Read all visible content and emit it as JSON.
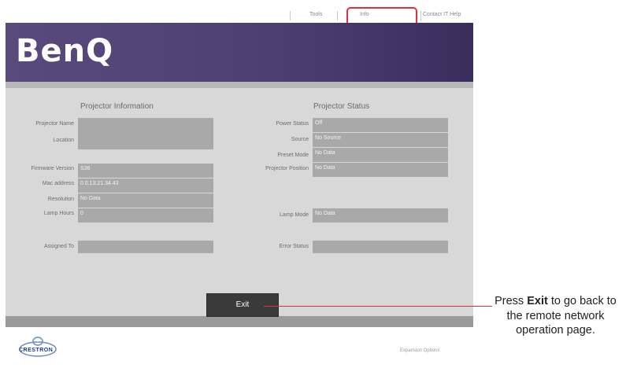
{
  "nav": {
    "tools": "Tools",
    "info": "Info",
    "contact": "Contact IT Help"
  },
  "brand": {
    "logo": "BenQ"
  },
  "projector_information": {
    "title": "Projector Information",
    "projector_name": {
      "label": "Projector Name",
      "value": ""
    },
    "location": {
      "label": "Location",
      "value": ""
    },
    "firmware_version": {
      "label": "Firmware Version",
      "value": "S36"
    },
    "mac_address": {
      "label": "Mac address",
      "value": "0.0.13.21.34.43"
    },
    "resolution": {
      "label": "Resolution",
      "value": "No Data"
    },
    "lamp_hours": {
      "label": "Lamp Hours",
      "value": "0"
    },
    "assigned_to": {
      "label": "Assigned To",
      "value": ""
    }
  },
  "projector_status": {
    "title": "Projector Status",
    "power_status": {
      "label": "Power Status",
      "value": "Off"
    },
    "source": {
      "label": "Source",
      "value": "No Source"
    },
    "preset_mode": {
      "label": "Preset Mode",
      "value": "No Data"
    },
    "projector_position": {
      "label": "Projector Position",
      "value": "No Data"
    },
    "lamp_mode": {
      "label": "Lamp Mode",
      "value": "No Data"
    },
    "error_status": {
      "label": "Error Status",
      "value": ""
    }
  },
  "exit_button": {
    "label": "Exit"
  },
  "footer": {
    "crestron": "CRESTRON",
    "expansion_options": "Expansion Options"
  },
  "callout": {
    "prefix": "Press",
    "bold": "Exit",
    "suffix": "to go back to the remote network operation page."
  },
  "colors": {
    "banner": "#4e3f73",
    "highlight": "#e0303a",
    "field": "#a9a9a9",
    "panel": "#d8d8d8"
  }
}
